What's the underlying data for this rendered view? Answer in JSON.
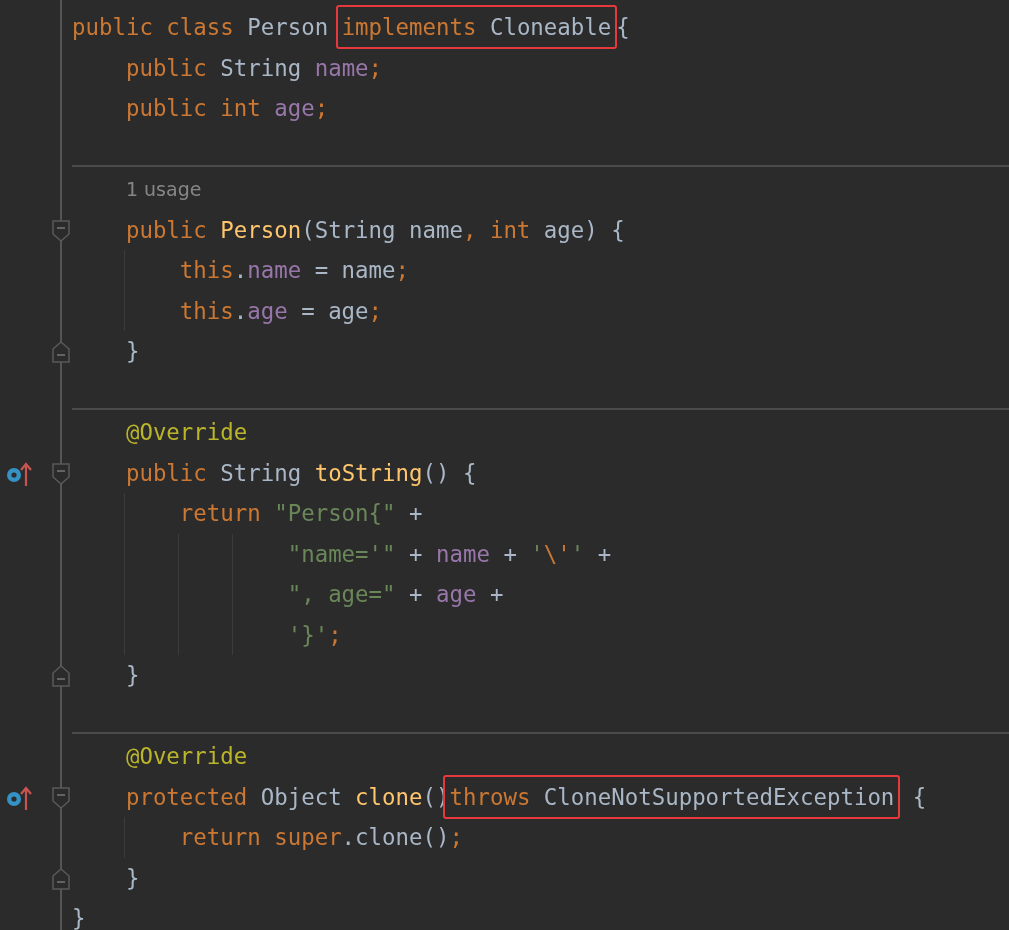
{
  "lines": [
    {
      "kind": "code",
      "segments": [
        {
          "kind": "tokens",
          "tokens": [
            {
              "text": "public class ",
              "kind": "keyword"
            },
            {
              "text": "Person ",
              "kind": "plain"
            }
          ]
        },
        {
          "kind": "box",
          "tokens": [
            {
              "text": "implements ",
              "kind": "keyword"
            },
            {
              "text": "Cloneable",
              "kind": "plain"
            }
          ]
        },
        {
          "kind": "tokens",
          "tokens": [
            {
              "text": "{",
              "kind": "plain"
            }
          ]
        }
      ]
    },
    {
      "kind": "code",
      "segments": [
        {
          "kind": "tokens",
          "tokens": [
            {
              "text": "    public ",
              "kind": "keyword"
            },
            {
              "text": "String ",
              "kind": "plain"
            },
            {
              "text": "name",
              "kind": "field"
            },
            {
              "text": ";",
              "kind": "keyword"
            }
          ]
        }
      ]
    },
    {
      "kind": "code",
      "segments": [
        {
          "kind": "tokens",
          "tokens": [
            {
              "text": "    public int ",
              "kind": "keyword"
            },
            {
              "text": "age",
              "kind": "field"
            },
            {
              "text": ";",
              "kind": "keyword"
            }
          ]
        }
      ]
    },
    {
      "kind": "separator"
    },
    {
      "kind": "hint",
      "text": "1 usage"
    },
    {
      "kind": "code",
      "gutter_icons": [
        {
          "kind": "foldstart"
        }
      ],
      "segments": [
        {
          "kind": "tokens",
          "tokens": [
            {
              "text": "    public ",
              "kind": "keyword"
            },
            {
              "text": "Person",
              "kind": "method"
            },
            {
              "text": "(String name",
              "kind": "plain"
            },
            {
              "text": ", int ",
              "kind": "keyword"
            },
            {
              "text": "age) {",
              "kind": "plain"
            }
          ]
        }
      ]
    },
    {
      "kind": "code",
      "segments": [
        {
          "kind": "tokens",
          "tokens": [
            {
              "text": "        this",
              "kind": "keyword"
            },
            {
              "text": ".",
              "kind": "plain"
            },
            {
              "text": "name",
              "kind": "field"
            },
            {
              "text": " = name",
              "kind": "plain"
            },
            {
              "text": ";",
              "kind": "keyword"
            }
          ]
        }
      ]
    },
    {
      "kind": "code",
      "segments": [
        {
          "kind": "tokens",
          "tokens": [
            {
              "text": "        this",
              "kind": "keyword"
            },
            {
              "text": ".",
              "kind": "plain"
            },
            {
              "text": "age",
              "kind": "field"
            },
            {
              "text": " = age",
              "kind": "plain"
            },
            {
              "text": ";",
              "kind": "keyword"
            }
          ]
        }
      ]
    },
    {
      "kind": "code",
      "gutter_icons": [
        {
          "kind": "foldend"
        }
      ],
      "segments": [
        {
          "kind": "tokens",
          "tokens": [
            {
              "text": "    }",
              "kind": "plain"
            }
          ]
        }
      ]
    },
    {
      "kind": "separator"
    },
    {
      "kind": "code",
      "segments": [
        {
          "kind": "tokens",
          "tokens": [
            {
              "text": "    @Override",
              "kind": "annotation"
            }
          ]
        }
      ]
    },
    {
      "kind": "code",
      "gutter_icons": [
        {
          "kind": "override"
        },
        {
          "kind": "foldstart"
        }
      ],
      "segments": [
        {
          "kind": "tokens",
          "tokens": [
            {
              "text": "    public ",
              "kind": "keyword"
            },
            {
              "text": "String ",
              "kind": "plain"
            },
            {
              "text": "toString",
              "kind": "method"
            },
            {
              "text": "() {",
              "kind": "plain"
            }
          ]
        }
      ]
    },
    {
      "kind": "code",
      "segments": [
        {
          "kind": "tokens",
          "tokens": [
            {
              "text": "        return ",
              "kind": "keyword"
            },
            {
              "text": "\"Person{\"",
              "kind": "string"
            },
            {
              "text": " +",
              "kind": "plain"
            }
          ]
        }
      ]
    },
    {
      "kind": "code",
      "segments": [
        {
          "kind": "tokens",
          "tokens": [
            {
              "text": "                \"name='\"",
              "kind": "string"
            },
            {
              "text": " + ",
              "kind": "plain"
            },
            {
              "text": "name",
              "kind": "field"
            },
            {
              "text": " + ",
              "kind": "plain"
            },
            {
              "text": "'",
              "kind": "string"
            },
            {
              "text": "\\'",
              "kind": "keyword"
            },
            {
              "text": "'",
              "kind": "string"
            },
            {
              "text": " +",
              "kind": "plain"
            }
          ]
        }
      ]
    },
    {
      "kind": "code",
      "segments": [
        {
          "kind": "tokens",
          "tokens": [
            {
              "text": "                \", age=\"",
              "kind": "string"
            },
            {
              "text": " + ",
              "kind": "plain"
            },
            {
              "text": "age",
              "kind": "field"
            },
            {
              "text": " +",
              "kind": "plain"
            }
          ]
        }
      ]
    },
    {
      "kind": "code",
      "segments": [
        {
          "kind": "tokens",
          "tokens": [
            {
              "text": "                '}'",
              "kind": "string"
            },
            {
              "text": ";",
              "kind": "keyword"
            }
          ]
        }
      ]
    },
    {
      "kind": "code",
      "gutter_icons": [
        {
          "kind": "foldend"
        }
      ],
      "segments": [
        {
          "kind": "tokens",
          "tokens": [
            {
              "text": "    }",
              "kind": "plain"
            }
          ]
        }
      ]
    },
    {
      "kind": "separator"
    },
    {
      "kind": "code",
      "segments": [
        {
          "kind": "tokens",
          "tokens": [
            {
              "text": "    @Override",
              "kind": "annotation"
            }
          ]
        }
      ]
    },
    {
      "kind": "code",
      "gutter_icons": [
        {
          "kind": "override"
        },
        {
          "kind": "foldstart"
        }
      ],
      "segments": [
        {
          "kind": "tokens",
          "tokens": [
            {
              "text": "    protected ",
              "kind": "keyword"
            },
            {
              "text": "Object ",
              "kind": "plain"
            },
            {
              "text": "clone",
              "kind": "method"
            },
            {
              "text": "()",
              "kind": "plain"
            }
          ]
        },
        {
          "kind": "box",
          "tokens": [
            {
              "text": "throws ",
              "kind": "keyword"
            },
            {
              "text": "CloneNotSupportedException",
              "kind": "plain"
            }
          ]
        },
        {
          "kind": "tokens",
          "tokens": [
            {
              "text": " {",
              "kind": "plain"
            }
          ]
        }
      ]
    },
    {
      "kind": "code",
      "segments": [
        {
          "kind": "tokens",
          "tokens": [
            {
              "text": "        return super",
              "kind": "keyword"
            },
            {
              "text": ".clone()",
              "kind": "plain"
            },
            {
              "text": ";",
              "kind": "keyword"
            }
          ]
        }
      ]
    },
    {
      "kind": "code",
      "gutter_icons": [
        {
          "kind": "foldend"
        }
      ],
      "segments": [
        {
          "kind": "tokens",
          "tokens": [
            {
              "text": "    }",
              "kind": "plain"
            }
          ]
        }
      ]
    },
    {
      "kind": "code",
      "segments": [
        {
          "kind": "tokens",
          "tokens": [
            {
              "text": "}",
              "kind": "plain"
            }
          ]
        }
      ]
    }
  ]
}
